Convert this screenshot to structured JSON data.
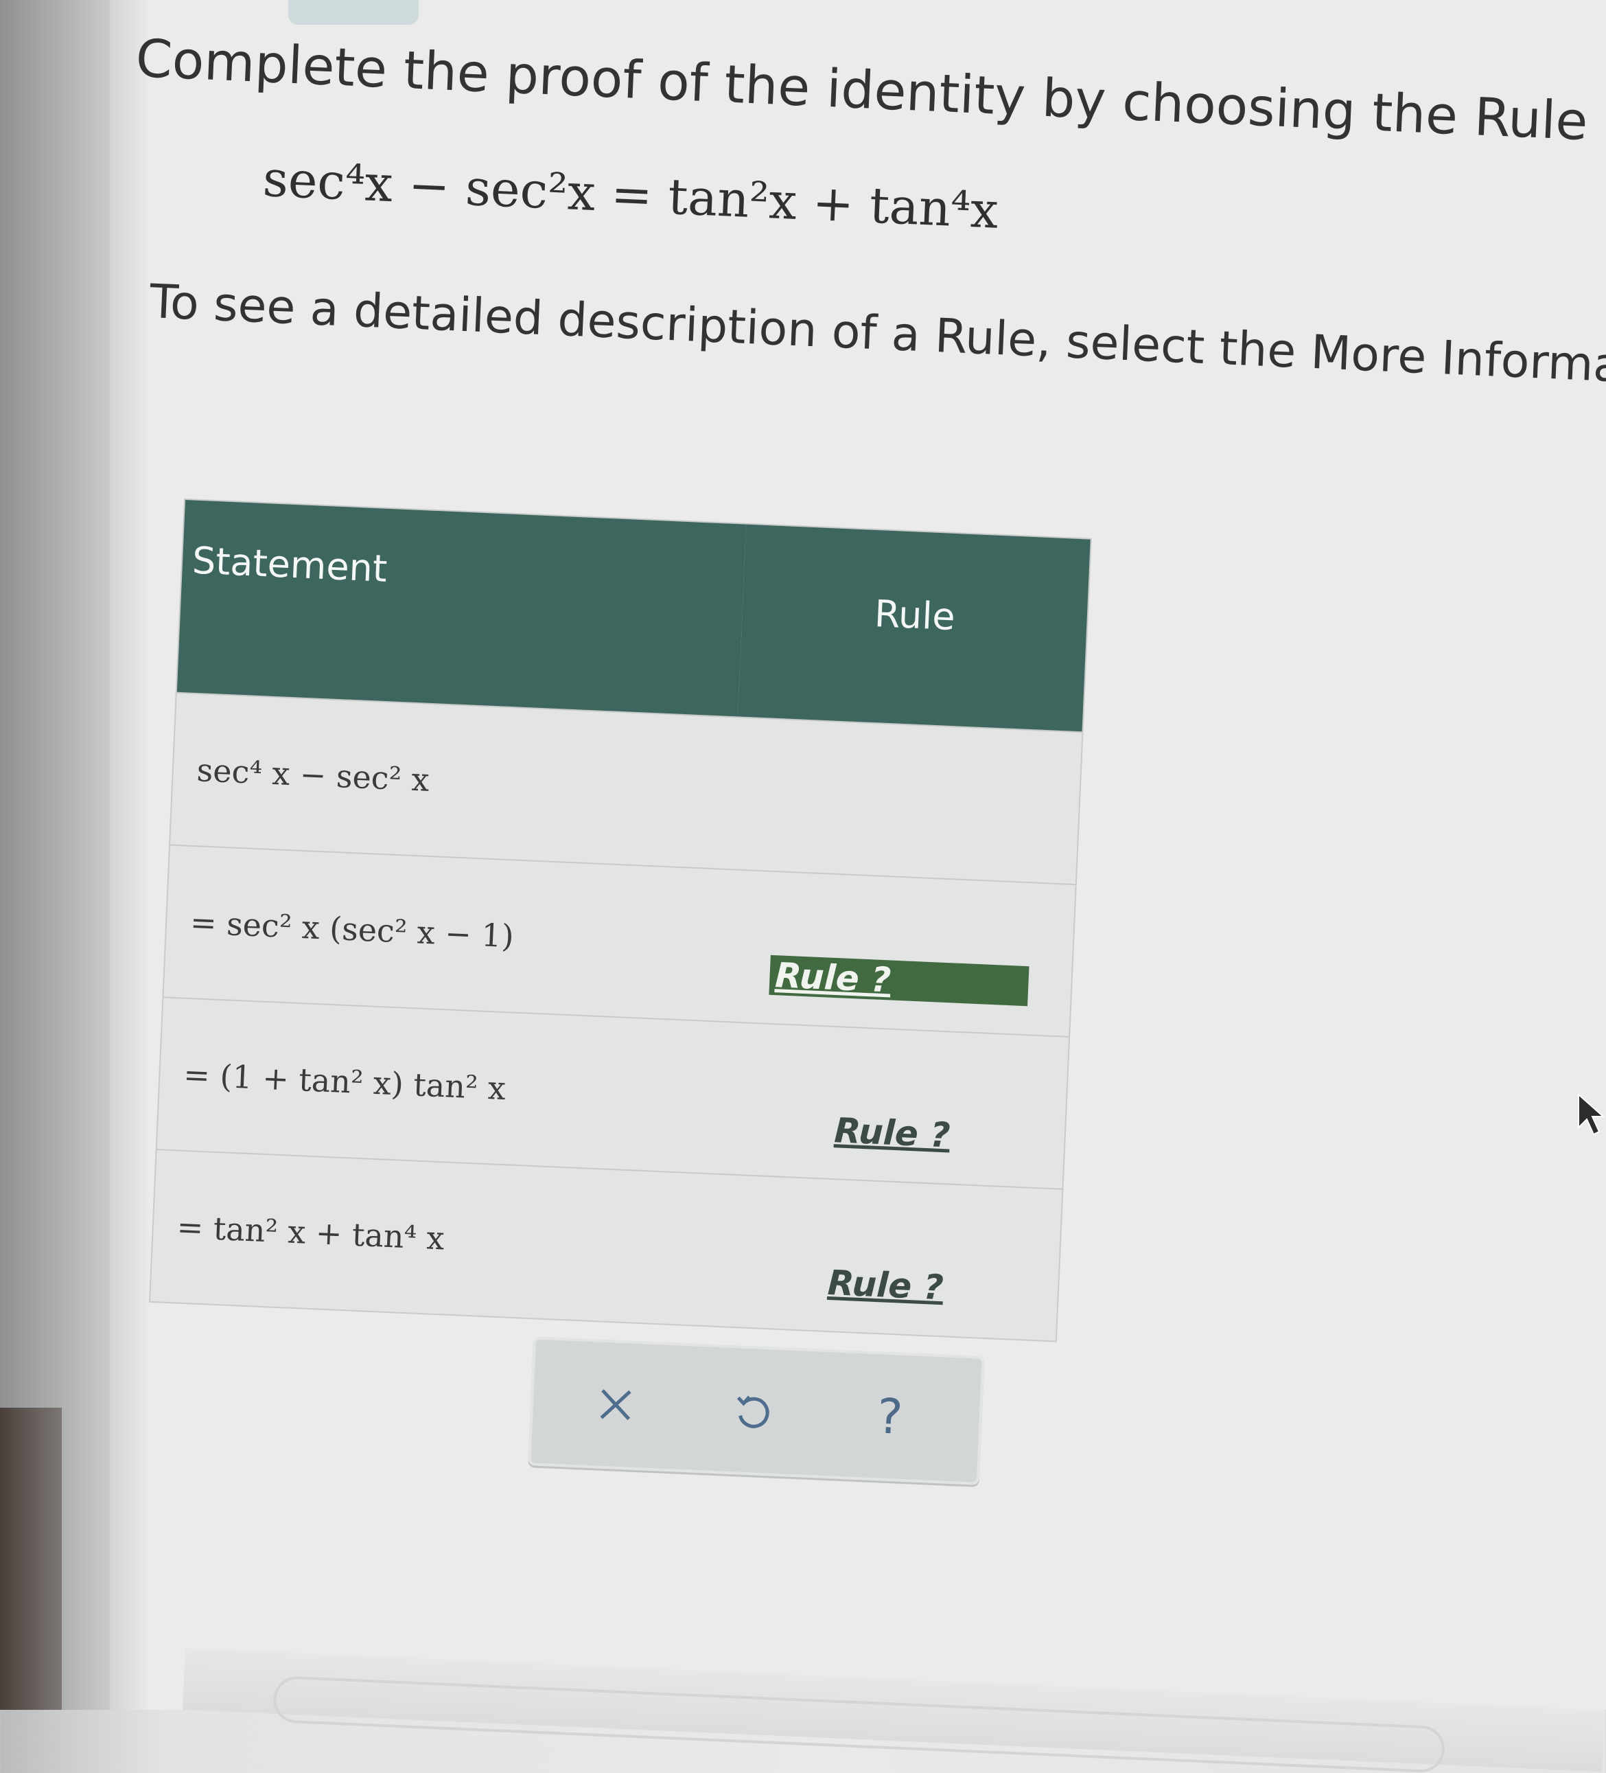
{
  "instructions": {
    "title": "Complete the proof of the identity by choosing the Rule that just",
    "identity": "sec⁴x − sec²x = tan²x + tan⁴x",
    "subtitle": "To see a detailed description of a Rule, select the More Informatior"
  },
  "table": {
    "headers": {
      "statement": "Statement",
      "rule": "Rule"
    },
    "rows": [
      {
        "statement": "sec⁴ x  −  sec² x",
        "rule": ""
      },
      {
        "statement": "=  sec² x (sec² x  −  1)",
        "rule": "Rule ?",
        "selected": true
      },
      {
        "statement": "=  (1  +  tan² x) tan² x",
        "rule": "Rule ?",
        "selected": false
      },
      {
        "statement": "=  tan² x  +  tan⁴ x",
        "rule": "Rule ?",
        "selected": false
      }
    ]
  },
  "toolbar": {
    "clear_icon": "close-icon",
    "undo_icon": "undo-icon",
    "help_label": "?"
  },
  "colors": {
    "header_bg": "#3d665e",
    "selected_rule_bg": "#416a40",
    "help_color": "#4d6a88"
  }
}
